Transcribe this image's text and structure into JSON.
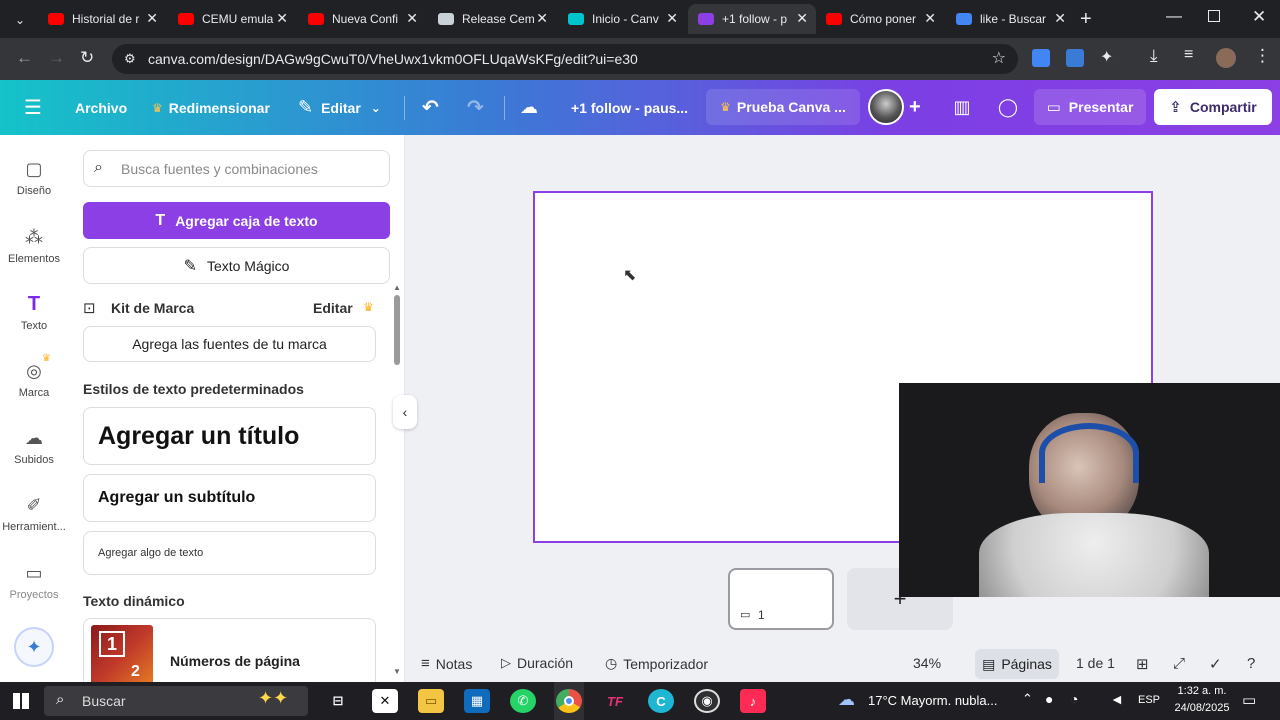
{
  "browser": {
    "tabs": [
      {
        "title": "Historial de r",
        "fav": "youtube-icon",
        "color": "#ff0000"
      },
      {
        "title": "CEMU emula",
        "fav": "youtube-icon",
        "color": "#ff0000"
      },
      {
        "title": "Nueva Confi",
        "fav": "youtube-icon",
        "color": "#ff0000"
      },
      {
        "title": "Release Cem",
        "fav": "github-icon",
        "color": "#c9d1d9"
      },
      {
        "title": "Inicio - Canv",
        "fav": "canva-icon",
        "color": "#00c4cc"
      },
      {
        "title": "+1 follow - p",
        "fav": "canva-icon",
        "color": "#8b3fe4",
        "active": true
      },
      {
        "title": "Cómo poner",
        "fav": "youtube-icon",
        "color": "#ff0000"
      },
      {
        "title": "like - Buscar",
        "fav": "google-icon",
        "color": "#4285f4"
      }
    ],
    "url": "canva.com/design/DAGw9gCwuT0/VheUwx1vkm0OFLUqaWsKFg/edit?ui=e30"
  },
  "toolbar": {
    "archivo": "Archivo",
    "redimensionar": "Redimensionar",
    "editar": "Editar",
    "doc_title": "+1 follow - paus...",
    "prueba": "Prueba Canva ...",
    "presentar": "Presentar",
    "compartir": "Compartir"
  },
  "rail": [
    {
      "label": "Diseño",
      "icon": "layout-icon"
    },
    {
      "label": "Elementos",
      "icon": "shapes-icon"
    },
    {
      "label": "Texto",
      "icon": "text-icon"
    },
    {
      "label": "Marca",
      "icon": "brand-icon"
    },
    {
      "label": "Subidos",
      "icon": "cloud-upload-icon"
    },
    {
      "label": "Herramient...",
      "icon": "tools-icon"
    },
    {
      "label": "Proyectos",
      "icon": "folder-icon"
    }
  ],
  "panel": {
    "search_placeholder": "Busca fuentes y combinaciones",
    "add_textbox": "Agregar caja de texto",
    "magic_text": "Texto Mágico",
    "brand_kit": "Kit de Marca",
    "brand_edit": "Editar",
    "brand_fonts": "Agrega las fuentes de tu marca",
    "defaults_heading": "Estilos de texto predeterminados",
    "title_style": "Agregar un título",
    "subtitle_style": "Agregar un subtítulo",
    "body_style": "Agregar algo de texto",
    "dynamic_heading": "Texto dinámico",
    "page_numbers": "Números de página",
    "page_numbers_thumb_a": "1",
    "page_numbers_thumb_b": "2"
  },
  "bottom": {
    "notas": "Notas",
    "duracion": "Duración",
    "temporizador": "Temporizador",
    "zoom": "34%",
    "paginas": "Páginas",
    "page_count": "1 de 1",
    "thumb_number": "1"
  },
  "taskbar": {
    "search": "Buscar",
    "weather": "17°C  Mayorm. nubla...",
    "lang": "ESP",
    "time": "1:32 a. m.",
    "date": "24/08/2025"
  }
}
